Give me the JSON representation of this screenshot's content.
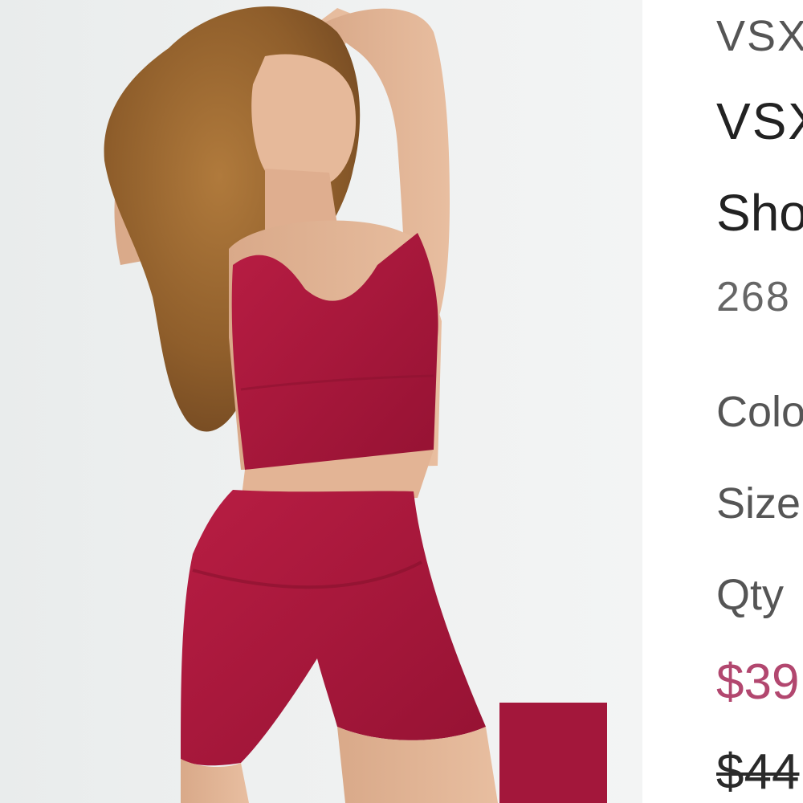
{
  "product": {
    "brand_small": "VSX",
    "brand_large": "VSX",
    "title": "Sho",
    "sku": "268",
    "color_label": "Colo",
    "size_label": "Size",
    "qty_label": "Qty",
    "sale_price": "$39",
    "original_price": "$44"
  },
  "media": {
    "main_image": "model-wearing-red-crop-top-and-shorts",
    "swatch": "color-swatch-red"
  },
  "colors": {
    "sale_price": "#b2476f",
    "product_red": "#a8173a",
    "swatch": "#a3173b",
    "background": "#eef0f0"
  }
}
